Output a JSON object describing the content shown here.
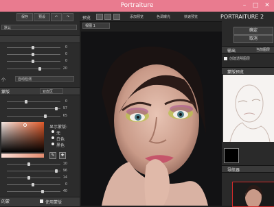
{
  "window": {
    "title": "Portraiture",
    "minimize": "–",
    "maximize": "□",
    "close": "✕"
  },
  "left": {
    "top_buttons": [
      "保存",
      "预设",
      "↶",
      "↷"
    ],
    "preset_select": "默认",
    "smoothing_values": [
      "0",
      "0",
      "0",
      "20"
    ],
    "mask_mode_label": "小",
    "mask_mode_select": "自动检测",
    "mask_header": "蒙版",
    "mask_select": "亚皮区",
    "mask_values": [
      "0",
      "97",
      "65"
    ],
    "show_mask_label": "显示蒙版:",
    "show_mask_options": [
      "无",
      "白色",
      "黑色"
    ],
    "enhance_values": [
      "10",
      "96",
      "14",
      "0",
      "40"
    ],
    "bottom_label": "的蒙",
    "use_mask_label": "使用蒙版"
  },
  "toolbar": {
    "preview_label": "预览",
    "item1": "添加预览",
    "item2": "色调曝光",
    "item3": "快速预览",
    "brand": "PORTRAITURE 2"
  },
  "view_tab": "视图 1",
  "right": {
    "ok": "确定",
    "cancel": "取消",
    "output_label": "输出",
    "output_select": "当前图层",
    "output_option": "创建透明图层",
    "mask_preview_label": "蒙版预览",
    "navigator_label": "导航器"
  },
  "colors": {
    "titlebar": "#e97b8f",
    "panel": "#2c2c2c",
    "accent": "#f0f0f0"
  }
}
